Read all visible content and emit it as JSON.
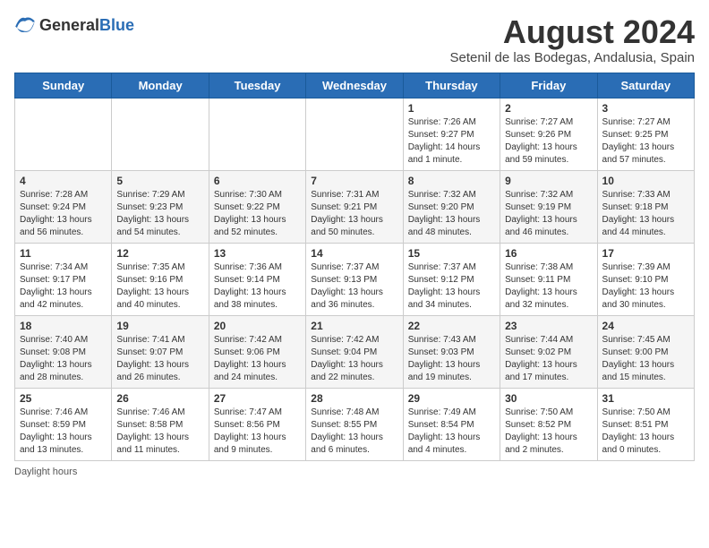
{
  "header": {
    "logo_general": "General",
    "logo_blue": "Blue",
    "main_title": "August 2024",
    "subtitle": "Setenil de las Bodegas, Andalusia, Spain"
  },
  "footer": {
    "daylight_label": "Daylight hours"
  },
  "columns": [
    "Sunday",
    "Monday",
    "Tuesday",
    "Wednesday",
    "Thursday",
    "Friday",
    "Saturday"
  ],
  "weeks": [
    [
      {
        "day": "",
        "info": ""
      },
      {
        "day": "",
        "info": ""
      },
      {
        "day": "",
        "info": ""
      },
      {
        "day": "",
        "info": ""
      },
      {
        "day": "1",
        "info": "Sunrise: 7:26 AM\nSunset: 9:27 PM\nDaylight: 14 hours\nand 1 minute."
      },
      {
        "day": "2",
        "info": "Sunrise: 7:27 AM\nSunset: 9:26 PM\nDaylight: 13 hours\nand 59 minutes."
      },
      {
        "day": "3",
        "info": "Sunrise: 7:27 AM\nSunset: 9:25 PM\nDaylight: 13 hours\nand 57 minutes."
      }
    ],
    [
      {
        "day": "4",
        "info": "Sunrise: 7:28 AM\nSunset: 9:24 PM\nDaylight: 13 hours\nand 56 minutes."
      },
      {
        "day": "5",
        "info": "Sunrise: 7:29 AM\nSunset: 9:23 PM\nDaylight: 13 hours\nand 54 minutes."
      },
      {
        "day": "6",
        "info": "Sunrise: 7:30 AM\nSunset: 9:22 PM\nDaylight: 13 hours\nand 52 minutes."
      },
      {
        "day": "7",
        "info": "Sunrise: 7:31 AM\nSunset: 9:21 PM\nDaylight: 13 hours\nand 50 minutes."
      },
      {
        "day": "8",
        "info": "Sunrise: 7:32 AM\nSunset: 9:20 PM\nDaylight: 13 hours\nand 48 minutes."
      },
      {
        "day": "9",
        "info": "Sunrise: 7:32 AM\nSunset: 9:19 PM\nDaylight: 13 hours\nand 46 minutes."
      },
      {
        "day": "10",
        "info": "Sunrise: 7:33 AM\nSunset: 9:18 PM\nDaylight: 13 hours\nand 44 minutes."
      }
    ],
    [
      {
        "day": "11",
        "info": "Sunrise: 7:34 AM\nSunset: 9:17 PM\nDaylight: 13 hours\nand 42 minutes."
      },
      {
        "day": "12",
        "info": "Sunrise: 7:35 AM\nSunset: 9:16 PM\nDaylight: 13 hours\nand 40 minutes."
      },
      {
        "day": "13",
        "info": "Sunrise: 7:36 AM\nSunset: 9:14 PM\nDaylight: 13 hours\nand 38 minutes."
      },
      {
        "day": "14",
        "info": "Sunrise: 7:37 AM\nSunset: 9:13 PM\nDaylight: 13 hours\nand 36 minutes."
      },
      {
        "day": "15",
        "info": "Sunrise: 7:37 AM\nSunset: 9:12 PM\nDaylight: 13 hours\nand 34 minutes."
      },
      {
        "day": "16",
        "info": "Sunrise: 7:38 AM\nSunset: 9:11 PM\nDaylight: 13 hours\nand 32 minutes."
      },
      {
        "day": "17",
        "info": "Sunrise: 7:39 AM\nSunset: 9:10 PM\nDaylight: 13 hours\nand 30 minutes."
      }
    ],
    [
      {
        "day": "18",
        "info": "Sunrise: 7:40 AM\nSunset: 9:08 PM\nDaylight: 13 hours\nand 28 minutes."
      },
      {
        "day": "19",
        "info": "Sunrise: 7:41 AM\nSunset: 9:07 PM\nDaylight: 13 hours\nand 26 minutes."
      },
      {
        "day": "20",
        "info": "Sunrise: 7:42 AM\nSunset: 9:06 PM\nDaylight: 13 hours\nand 24 minutes."
      },
      {
        "day": "21",
        "info": "Sunrise: 7:42 AM\nSunset: 9:04 PM\nDaylight: 13 hours\nand 22 minutes."
      },
      {
        "day": "22",
        "info": "Sunrise: 7:43 AM\nSunset: 9:03 PM\nDaylight: 13 hours\nand 19 minutes."
      },
      {
        "day": "23",
        "info": "Sunrise: 7:44 AM\nSunset: 9:02 PM\nDaylight: 13 hours\nand 17 minutes."
      },
      {
        "day": "24",
        "info": "Sunrise: 7:45 AM\nSunset: 9:00 PM\nDaylight: 13 hours\nand 15 minutes."
      }
    ],
    [
      {
        "day": "25",
        "info": "Sunrise: 7:46 AM\nSunset: 8:59 PM\nDaylight: 13 hours\nand 13 minutes."
      },
      {
        "day": "26",
        "info": "Sunrise: 7:46 AM\nSunset: 8:58 PM\nDaylight: 13 hours\nand 11 minutes."
      },
      {
        "day": "27",
        "info": "Sunrise: 7:47 AM\nSunset: 8:56 PM\nDaylight: 13 hours\nand 9 minutes."
      },
      {
        "day": "28",
        "info": "Sunrise: 7:48 AM\nSunset: 8:55 PM\nDaylight: 13 hours\nand 6 minutes."
      },
      {
        "day": "29",
        "info": "Sunrise: 7:49 AM\nSunset: 8:54 PM\nDaylight: 13 hours\nand 4 minutes."
      },
      {
        "day": "30",
        "info": "Sunrise: 7:50 AM\nSunset: 8:52 PM\nDaylight: 13 hours\nand 2 minutes."
      },
      {
        "day": "31",
        "info": "Sunrise: 7:50 AM\nSunset: 8:51 PM\nDaylight: 13 hours\nand 0 minutes."
      }
    ]
  ]
}
